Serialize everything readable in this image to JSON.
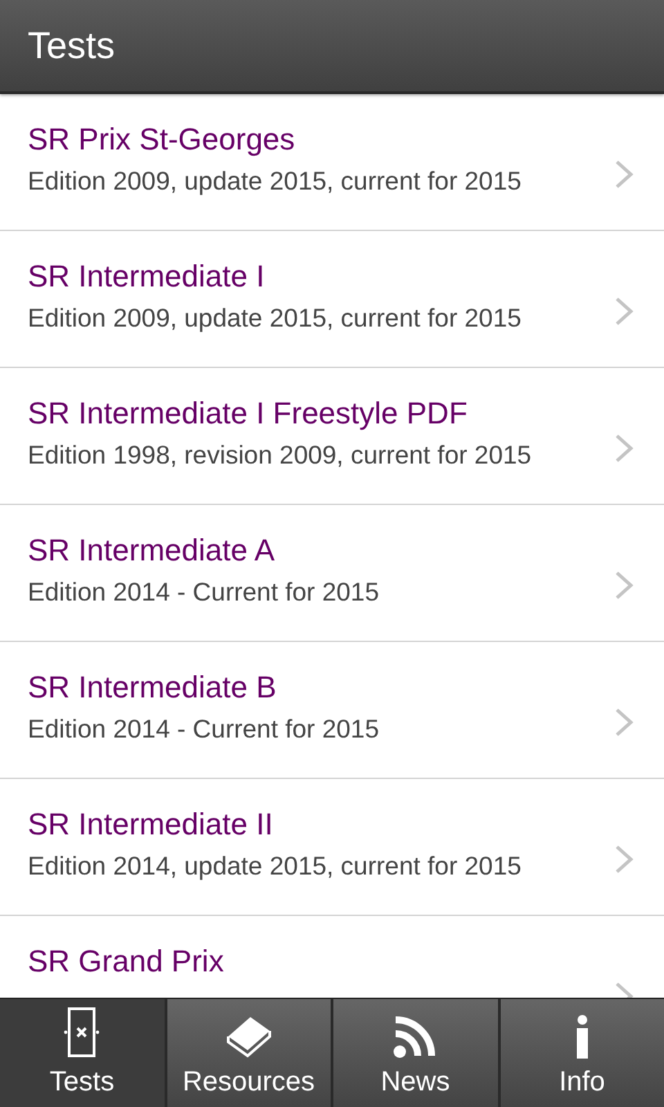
{
  "header": {
    "title": "Tests"
  },
  "items": [
    {
      "title": "SR Prix St-Georges",
      "subtitle": "Edition 2009, update 2015, current for 2015"
    },
    {
      "title": "SR Intermediate I",
      "subtitle": "Edition 2009, update 2015, current for 2015"
    },
    {
      "title": "SR Intermediate I Freestyle PDF",
      "subtitle": "Edition 1998, revision 2009, current for 2015"
    },
    {
      "title": "SR Intermediate A",
      "subtitle": "Edition 2014 - Current for 2015"
    },
    {
      "title": "SR Intermediate B",
      "subtitle": "Edition 2014 - Current for 2015"
    },
    {
      "title": "SR Intermediate II",
      "subtitle": "Edition 2014, update 2015, current for 2015"
    },
    {
      "title": "SR Grand Prix"
    }
  ],
  "tabs": [
    {
      "label": "Tests",
      "kind": "arena",
      "selected": true
    },
    {
      "label": "Resources",
      "kind": "book",
      "selected": false
    },
    {
      "label": "News",
      "kind": "feed",
      "selected": false
    },
    {
      "label": "Info",
      "kind": "info",
      "selected": false
    }
  ]
}
